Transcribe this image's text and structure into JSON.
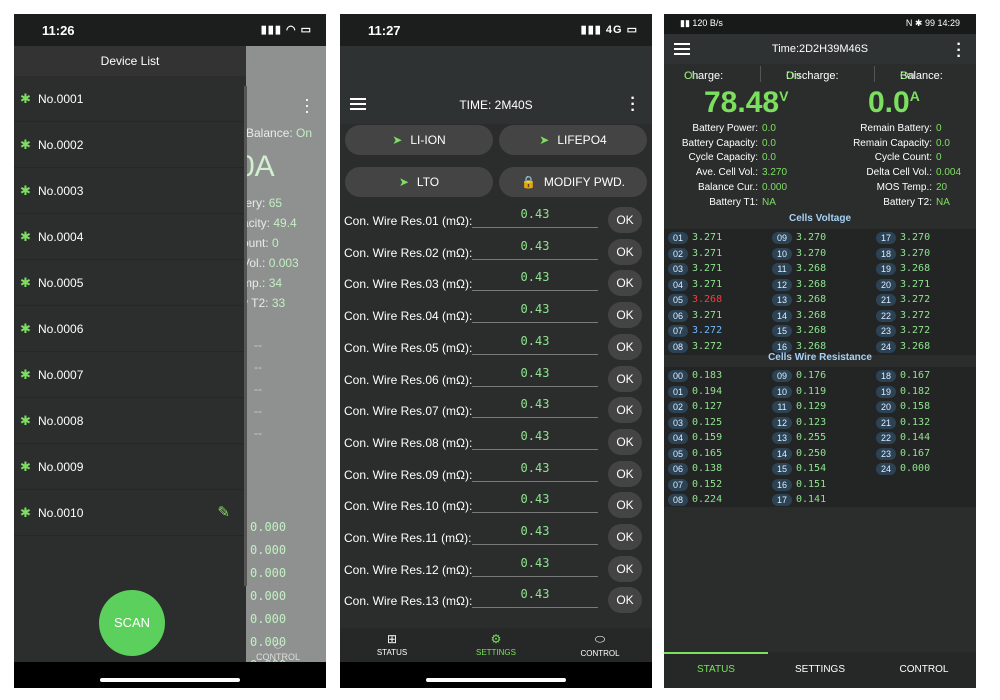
{
  "phone1": {
    "time": "11:26",
    "status_icons": "▮▮▮ ◠ ▭",
    "drawer_title": "Device List",
    "devices": [
      "No.0001",
      "No.0002",
      "No.0003",
      "No.0004",
      "No.0005",
      "No.0006",
      "No.0007",
      "No.0008",
      "No.0009",
      "No.0010"
    ],
    "scan": "SCAN",
    "bg": {
      "balance_label": "Balance:",
      "balance_value": "On",
      "zero": "0A",
      "rows": [
        {
          "label": "tery:",
          "value": "65"
        },
        {
          "label": "acity:",
          "value": "49.4"
        },
        {
          "label": "ount:",
          "value": "0"
        },
        {
          "label": "Vol.:",
          "value": "0.003"
        },
        {
          "label": "mp.:",
          "value": "34"
        },
        {
          "label": "y T2:",
          "value": "33"
        }
      ],
      "dashes": [
        "--",
        "--",
        "--",
        "--",
        "--"
      ],
      "zeros": [
        "0.000",
        "0.000",
        "0.000",
        "0.000",
        "0.000",
        "0.000",
        "0.000"
      ],
      "control": "CONTROL"
    }
  },
  "phone2": {
    "time": "11:27",
    "status_icons": "▮▮▮ 4G ▭",
    "title": "TIME: 2M40S",
    "buttons": {
      "li_ion": "LI-ION",
      "lifepo4": "LIFEPO4",
      "lto": "LTO",
      "modify": "MODIFY PWD."
    },
    "rows": [
      {
        "label": "Con. Wire Res.01 (mΩ):",
        "value": "0.43"
      },
      {
        "label": "Con. Wire Res.02 (mΩ):",
        "value": "0.43"
      },
      {
        "label": "Con. Wire Res.03 (mΩ):",
        "value": "0.43"
      },
      {
        "label": "Con. Wire Res.04 (mΩ):",
        "value": "0.43"
      },
      {
        "label": "Con. Wire Res.05 (mΩ):",
        "value": "0.43"
      },
      {
        "label": "Con. Wire Res.06 (mΩ):",
        "value": "0.43"
      },
      {
        "label": "Con. Wire Res.07 (mΩ):",
        "value": "0.43"
      },
      {
        "label": "Con. Wire Res.08 (mΩ):",
        "value": "0.43"
      },
      {
        "label": "Con. Wire Res.09 (mΩ):",
        "value": "0.43"
      },
      {
        "label": "Con. Wire Res.10 (mΩ):",
        "value": "0.43"
      },
      {
        "label": "Con. Wire Res.11 (mΩ):",
        "value": "0.43"
      },
      {
        "label": "Con. Wire Res.12 (mΩ):",
        "value": "0.43"
      },
      {
        "label": "Con. Wire Res.13 (mΩ):",
        "value": "0.43"
      }
    ],
    "ok": "OK",
    "nav": {
      "status": "STATUS",
      "settings": "SETTINGS",
      "control": "CONTROL"
    }
  },
  "phone3": {
    "status_left": "▮▮ 120 B/s",
    "status_right": "N ✱ 99 14:29",
    "title": "Time:2D2H39M46S",
    "charge_label": "Charge:",
    "charge_value": "On",
    "discharge_label": "Discharge:",
    "discharge_value": "On",
    "balance_label": "Balance:",
    "balance_value": "On",
    "voltage": "78.48",
    "voltage_unit": "V",
    "current": "0.0",
    "current_unit": "A",
    "left_kv": [
      {
        "label": "Battery Power:",
        "value": "0.0"
      },
      {
        "label": "Battery Capacity:",
        "value": "0.0"
      },
      {
        "label": "Cycle Capacity:",
        "value": "0.0"
      },
      {
        "label": "Ave. Cell Vol.:",
        "value": "3.270"
      },
      {
        "label": "Balance Cur.:",
        "value": "0.000"
      },
      {
        "label": "Battery T1:",
        "value": "NA"
      }
    ],
    "right_kv": [
      {
        "label": "Remain Battery:",
        "value": "0"
      },
      {
        "label": "Remain Capacity:",
        "value": "0.0"
      },
      {
        "label": "Cycle Count:",
        "value": "0"
      },
      {
        "label": "Delta Cell Vol.:",
        "value": "0.004"
      },
      {
        "label": "MOS Temp.:",
        "value": "20"
      },
      {
        "label": "Battery T2:",
        "value": "NA"
      }
    ],
    "cells_title": "Cells Voltage",
    "cells": [
      {
        "n": "01",
        "v": "3.271"
      },
      {
        "n": "02",
        "v": "3.271"
      },
      {
        "n": "03",
        "v": "3.271"
      },
      {
        "n": "04",
        "v": "3.271"
      },
      {
        "n": "05",
        "v": "3.268",
        "c": "red"
      },
      {
        "n": "06",
        "v": "3.271"
      },
      {
        "n": "07",
        "v": "3.272",
        "c": "blue"
      },
      {
        "n": "08",
        "v": "3.272"
      },
      {
        "n": "09",
        "v": "3.270"
      },
      {
        "n": "10",
        "v": "3.270"
      },
      {
        "n": "11",
        "v": "3.268"
      },
      {
        "n": "12",
        "v": "3.268"
      },
      {
        "n": "13",
        "v": "3.268"
      },
      {
        "n": "14",
        "v": "3.268"
      },
      {
        "n": "15",
        "v": "3.268"
      },
      {
        "n": "16",
        "v": "3.268"
      },
      {
        "n": "17",
        "v": "3.270"
      },
      {
        "n": "18",
        "v": "3.270"
      },
      {
        "n": "19",
        "v": "3.268"
      },
      {
        "n": "20",
        "v": "3.271"
      },
      {
        "n": "21",
        "v": "3.272"
      },
      {
        "n": "22",
        "v": "3.272"
      },
      {
        "n": "23",
        "v": "3.272"
      },
      {
        "n": "24",
        "v": "3.268"
      }
    ],
    "wires_title": "Cells Wire Resistance",
    "wires": [
      {
        "n": "00",
        "v": "0.183"
      },
      {
        "n": "01",
        "v": "0.194"
      },
      {
        "n": "02",
        "v": "0.127"
      },
      {
        "n": "03",
        "v": "0.125"
      },
      {
        "n": "04",
        "v": "0.159"
      },
      {
        "n": "05",
        "v": "0.165"
      },
      {
        "n": "06",
        "v": "0.138"
      },
      {
        "n": "07",
        "v": "0.152"
      },
      {
        "n": "08",
        "v": "0.224"
      },
      {
        "n": "09",
        "v": "0.176"
      },
      {
        "n": "10",
        "v": "0.119"
      },
      {
        "n": "11",
        "v": "0.129"
      },
      {
        "n": "12",
        "v": "0.123"
      },
      {
        "n": "13",
        "v": "0.255"
      },
      {
        "n": "14",
        "v": "0.250"
      },
      {
        "n": "15",
        "v": "0.154"
      },
      {
        "n": "16",
        "v": "0.151"
      },
      {
        "n": "17",
        "v": "0.141"
      },
      {
        "n": "18",
        "v": "0.167"
      },
      {
        "n": "19",
        "v": "0.182"
      },
      {
        "n": "20",
        "v": "0.158"
      },
      {
        "n": "21",
        "v": "0.132"
      },
      {
        "n": "22",
        "v": "0.144"
      },
      {
        "n": "23",
        "v": "0.167"
      },
      {
        "n": "24",
        "v": "0.000"
      }
    ],
    "nav": {
      "status": "STATUS",
      "settings": "SETTINGS",
      "control": "CONTROL"
    }
  }
}
